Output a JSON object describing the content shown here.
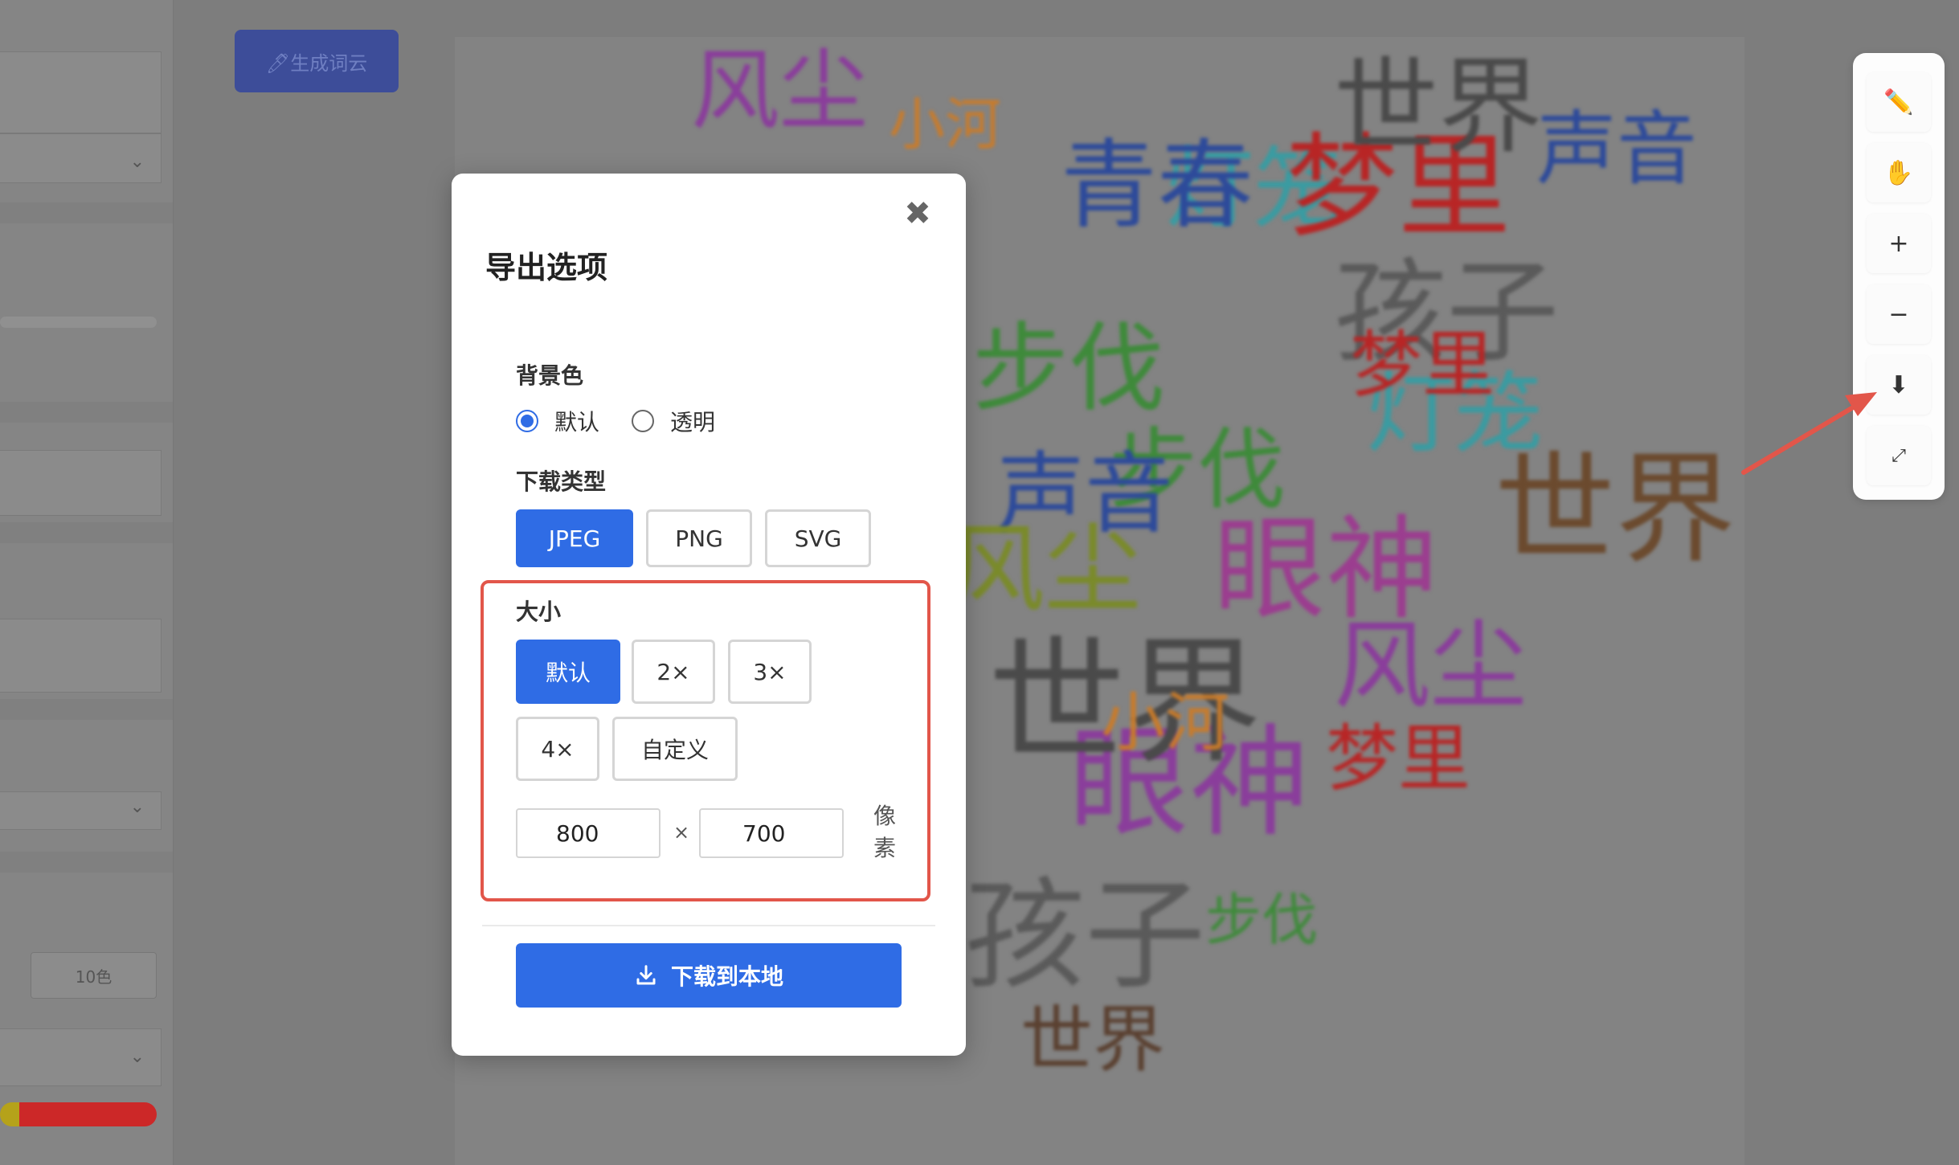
{
  "background_app": {
    "generate_button_label": "🖊生成词云",
    "left_panel": {
      "small_button_label": "10色",
      "colorbar": [
        "#b5a21a",
        "#cc2828",
        "#c62222"
      ]
    },
    "word_cloud": [
      {
        "t": "风尘",
        "c": "#8a3d9b"
      },
      {
        "t": "小河",
        "c": "#c97b2a"
      },
      {
        "t": "灯笼",
        "c": "#3a9ba1"
      },
      {
        "t": "梦里",
        "c": "#b82525"
      },
      {
        "t": "世界",
        "c": "#4a4a4a"
      },
      {
        "t": "声音",
        "c": "#2d4a9a"
      },
      {
        "t": "孩子",
        "c": "#5a5a5a"
      },
      {
        "t": "步伐",
        "c": "#3e8a3a"
      },
      {
        "t": "眼神",
        "c": "#9b3d8f"
      },
      {
        "t": "青春",
        "c": "#2d4a9a"
      },
      {
        "t": "世界",
        "c": "#6b4a2e"
      },
      {
        "t": "眼神",
        "c": "#8a3d9b"
      },
      {
        "t": "风尘",
        "c": "#8a3d9b"
      },
      {
        "t": "梦里",
        "c": "#b82525"
      },
      {
        "t": "步伐",
        "c": "#3e8a3a"
      },
      {
        "t": "世界",
        "c": "#4a4a4a"
      },
      {
        "t": "孩子",
        "c": "#5a5a5a"
      },
      {
        "t": "世界",
        "c": "#5a4030"
      },
      {
        "t": "灯笼",
        "c": "#3a9ba1"
      },
      {
        "t": "声音",
        "c": "#2d4a9a"
      },
      {
        "t": "小河",
        "c": "#c97b2a"
      },
      {
        "t": "风尘",
        "c": "#7a8a2a"
      },
      {
        "t": "梦里",
        "c": "#b82525"
      },
      {
        "t": "步伐",
        "c": "#3e8a3a"
      }
    ]
  },
  "toolbar": {
    "tools": [
      {
        "name": "edit-tool",
        "icon": "✏️"
      },
      {
        "name": "pan-tool",
        "icon": "✋"
      },
      {
        "name": "zoom-in-tool",
        "icon": "+"
      },
      {
        "name": "zoom-out-tool",
        "icon": "−"
      },
      {
        "name": "download-tool",
        "icon": "⬇"
      },
      {
        "name": "fullscreen-tool",
        "icon": "⤢"
      }
    ],
    "arrow_color": "#e2564a"
  },
  "modal": {
    "title": "导出选项",
    "close_icon": "✖",
    "background": {
      "label": "背景色",
      "options": [
        "默认",
        "透明"
      ],
      "selected": "默认"
    },
    "file_type": {
      "label": "下载类型",
      "options": [
        "JPEG",
        "PNG",
        "SVG"
      ],
      "selected": "JPEG"
    },
    "size": {
      "label": "大小",
      "options": [
        "默认",
        "2×",
        "3×",
        "4×",
        "自定义"
      ],
      "selected": "默认",
      "width": "800",
      "height": "700",
      "times": "×",
      "unit_line1": "像",
      "unit_line2": "素"
    },
    "download_label": "下载到本地",
    "accent_color": "#2f6ce5",
    "highlight_color": "#e2564a"
  }
}
